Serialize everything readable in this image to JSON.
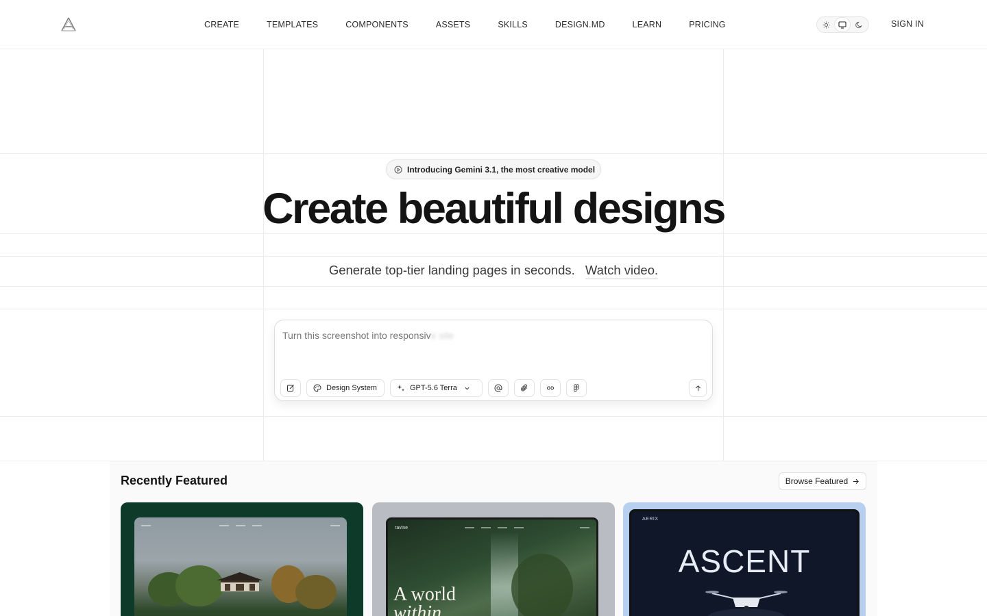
{
  "header": {
    "nav": [
      "CREATE",
      "TEMPLATES",
      "COMPONENTS",
      "ASSETS",
      "SKILLS",
      "DESIGN.MD",
      "LEARN",
      "PRICING"
    ],
    "sign_in": "SIGN IN"
  },
  "hero": {
    "badge": "Introducing Gemini 3.1, the most creative model",
    "title": "Create beautiful designs",
    "subtitle": "Generate top-tier landing pages in seconds.",
    "watch_link": "Watch video."
  },
  "prompt": {
    "text_visible": "Turn this screenshot into responsiv",
    "text_faded": "e site",
    "design_system_label": "Design System",
    "model_label": "GPT-5.6 Terra"
  },
  "featured": {
    "title": "Recently Featured",
    "browse_label": "Browse Featured",
    "cards": [
      {
        "brand": "",
        "headline": ""
      },
      {
        "brand": "ravine",
        "headline_line1": "A world",
        "headline_line2": "within."
      },
      {
        "brand": "AERIX",
        "headline": "ASCENT"
      }
    ]
  },
  "colors": {
    "grid_line": "#ececec",
    "text_primary": "#141414",
    "card1_bg": "#0d3a29",
    "card2_bg": "#b9bcc3",
    "card3_bg": "#b7d0f0"
  }
}
